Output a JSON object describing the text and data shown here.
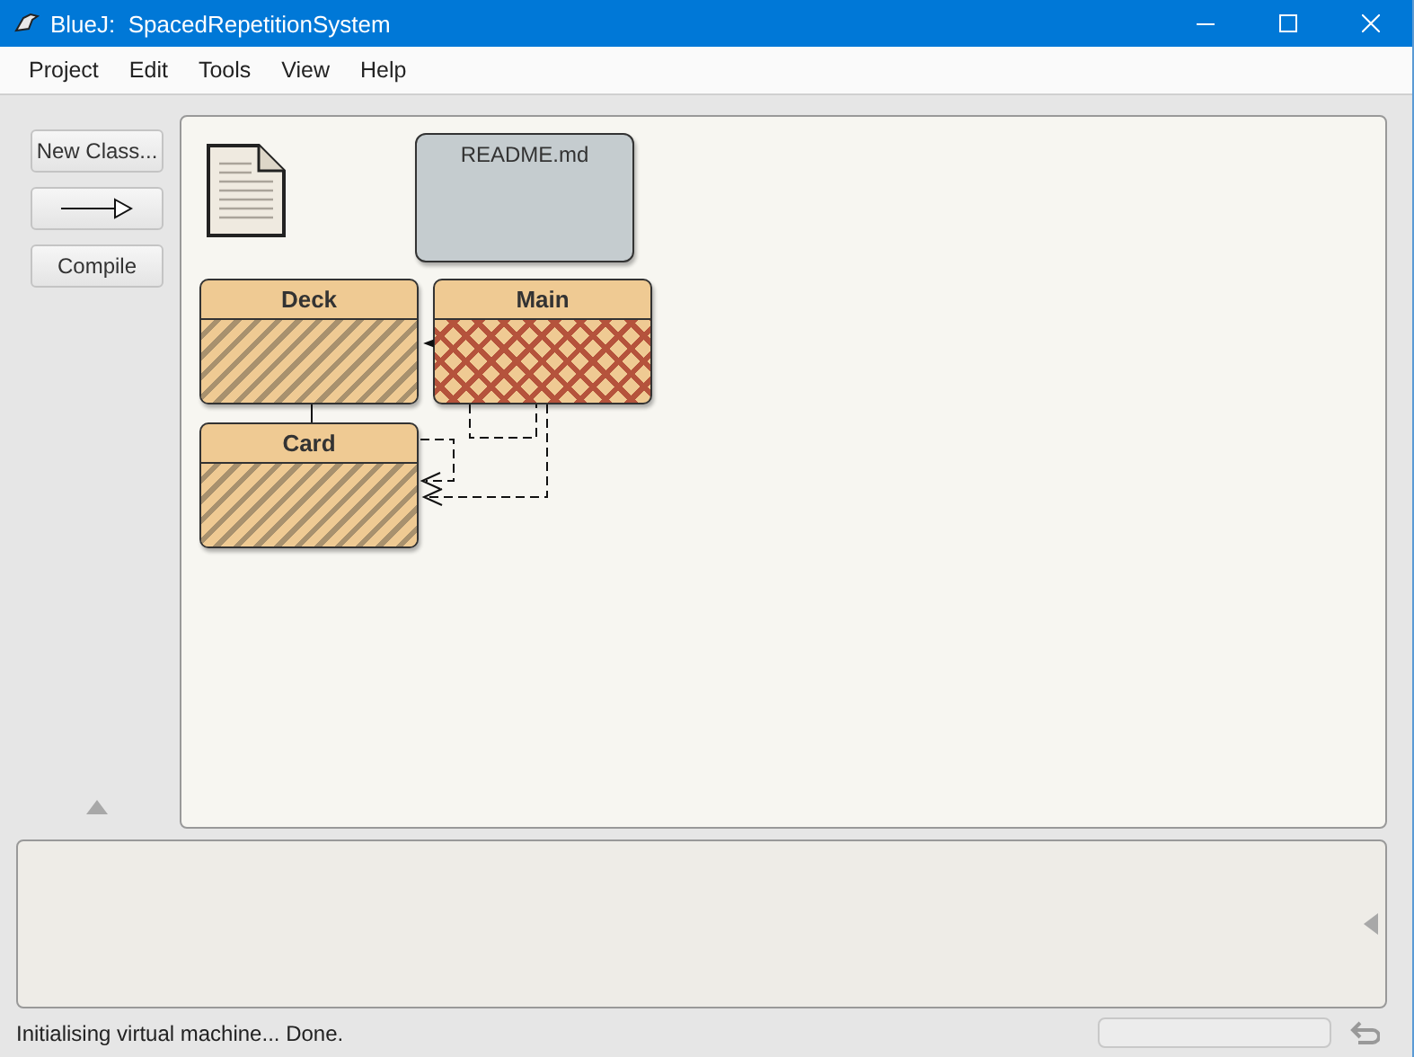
{
  "window": {
    "title": "BlueJ:  SpacedRepetitionSystem"
  },
  "menu": [
    "Project",
    "Edit",
    "Tools",
    "View",
    "Help"
  ],
  "tool_buttons": [
    {
      "kind": "text",
      "label": "New Class..."
    },
    {
      "kind": "arrow"
    },
    {
      "kind": "text",
      "label": "Compile"
    }
  ],
  "diagram": {
    "readme": {
      "label": "README.md"
    },
    "classes": [
      {
        "name": "Deck",
        "compiled": false,
        "has_error": false
      },
      {
        "name": "Main",
        "compiled": false,
        "has_error": true
      },
      {
        "name": "Card",
        "compiled": false,
        "has_error": false
      }
    ]
  },
  "status_bar": {
    "message": "Initialising virtual machine... Done.",
    "progress": {
      "level": 0
    }
  }
}
